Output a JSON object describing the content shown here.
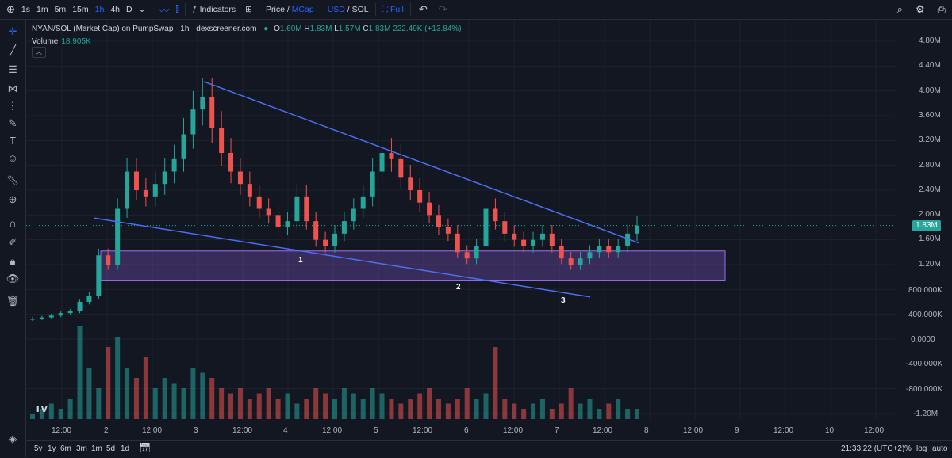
{
  "topbar": {
    "timeframes": [
      "1s",
      "1m",
      "5m",
      "15m",
      "1h",
      "4h",
      "D"
    ],
    "active_timeframe": "1h",
    "indicators_label": "Indicators",
    "price_label": "Price",
    "mcap_label": "MCap",
    "usd_label": "USD",
    "sol_label": "SOL",
    "full_label": "Full"
  },
  "legend": {
    "symbol": "NYAN/SOL (Market Cap) on PumpSwap · 1h · dexscreener.com",
    "o_label": "O",
    "o_value": "1.60M",
    "h_label": "H",
    "h_value": "1.83M",
    "l_label": "L",
    "l_value": "1.57M",
    "c_label": "C",
    "c_value": "1.83M",
    "change": "222.49K (+13.84%)",
    "volume_label": "Volume",
    "volume_value": "18.905K"
  },
  "y_axis_labels": [
    "4.80M",
    "4.40M",
    "4.00M",
    "3.60M",
    "3.20M",
    "2.80M",
    "2.40M",
    "2.00M",
    "1.60M",
    "1.20M",
    "800.000K",
    "400.000K",
    "0.0000",
    "-400.000K",
    "-800.000K",
    "-1.20M"
  ],
  "current_price": "1.83M",
  "x_axis_labels": [
    "12:00",
    "2",
    "12:00",
    "3",
    "12:00",
    "4",
    "12:00",
    "5",
    "12:00",
    "6",
    "12:00",
    "7",
    "12:00",
    "8",
    "12:00",
    "9",
    "12:00",
    "10",
    "12:00"
  ],
  "wave_labels": [
    "1",
    "2",
    "3"
  ],
  "bottombar": {
    "ranges": [
      "5y",
      "1y",
      "6m",
      "3m",
      "1m",
      "5d",
      "1d"
    ],
    "clock": "21:33:22 (UTC+2)",
    "percent": "%",
    "log": "log",
    "auto": "auto"
  },
  "colors": {
    "up": "#26a69a",
    "down": "#ef5350",
    "trendline": "#4c6ef5",
    "zone_fill": "#7e57c2",
    "background": "#131722"
  },
  "chart_data": {
    "type": "candlestick",
    "title": "NYAN/SOL (Market Cap) on PumpSwap · 1h · dexscreener.com",
    "ylim": [
      -1300000,
      5000000
    ],
    "close_series_approx": [
      330000,
      350000,
      380000,
      420000,
      450000,
      600000,
      700000,
      1350000,
      1200000,
      2100000,
      2700000,
      2400000,
      2300000,
      2500000,
      2700000,
      2900000,
      3300000,
      3700000,
      3900000,
      3400000,
      3000000,
      2700000,
      2500000,
      2300000,
      2100000,
      2000000,
      1800000,
      1900000,
      2300000,
      1900000,
      1600000,
      1500000,
      1700000,
      1900000,
      2100000,
      2300000,
      2700000,
      3000000,
      2900000,
      2600000,
      2400000,
      2200000,
      2000000,
      1800000,
      1700000,
      1400000,
      1300000,
      1500000,
      2100000,
      1900000,
      1700000,
      1600000,
      1500000,
      1600000,
      1700000,
      1500000,
      1300000,
      1200000,
      1300000,
      1400000,
      1500000,
      1400000,
      1500000,
      1700000,
      1830000
    ],
    "volume_series_approx": [
      0.05,
      0.1,
      0.15,
      0.1,
      0.2,
      0.9,
      0.5,
      0.3,
      0.7,
      0.8,
      0.5,
      0.4,
      0.6,
      0.3,
      0.4,
      0.35,
      0.3,
      0.5,
      0.45,
      0.4,
      0.3,
      0.25,
      0.3,
      0.2,
      0.25,
      0.3,
      0.2,
      0.25,
      0.15,
      0.2,
      0.3,
      0.25,
      0.2,
      0.3,
      0.25,
      0.2,
      0.3,
      0.25,
      0.2,
      0.15,
      0.2,
      0.25,
      0.3,
      0.2,
      0.15,
      0.2,
      0.3,
      0.2,
      0.25,
      0.7,
      0.2,
      0.15,
      0.1,
      0.15,
      0.2,
      0.1,
      0.15,
      0.3,
      0.15,
      0.2,
      0.1,
      0.15,
      0.2,
      0.1,
      0.1
    ]
  }
}
